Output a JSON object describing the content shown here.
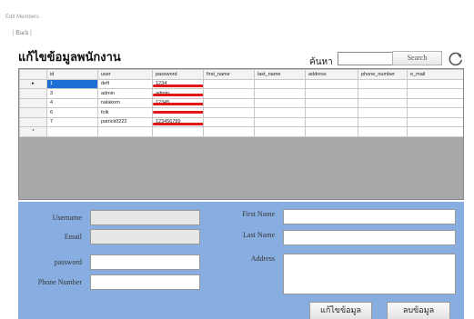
{
  "window": {
    "title": "Edit Members"
  },
  "nav": {
    "back_label": "| Back |"
  },
  "page": {
    "heading": "แก้ไขข้อมูลพนักงาน"
  },
  "search": {
    "label": "ค้นหา",
    "value": "",
    "button_label": "Search"
  },
  "grid": {
    "columns": [
      "id",
      "user",
      "password",
      "first_name",
      "last_name",
      "address",
      "phone_number",
      "e_mail"
    ],
    "rows": [
      {
        "marker": "▸",
        "id": "1",
        "user": "deft",
        "password": "1234"
      },
      {
        "marker": "",
        "id": "3",
        "user": "admin",
        "password": "admin"
      },
      {
        "marker": "",
        "id": "4",
        "user": "nalakom",
        "password": "12345"
      },
      {
        "marker": "",
        "id": "6",
        "user": "folk",
        "password": ""
      },
      {
        "marker": "",
        "id": "7",
        "user": "patrick0222",
        "password": "123456789"
      }
    ],
    "new_row_marker": "*"
  },
  "form": {
    "username_label": "Username",
    "email_label": "Email",
    "password_label": "password",
    "phone_label": "Phone Number",
    "first_name_label": "First Name",
    "last_name_label": "Last Name",
    "address_label": "Address",
    "edit_button": "แก้ไขข้อมูล",
    "delete_button": "ลบข้อมูล"
  },
  "colors": {
    "panel": "#88aee1",
    "selection": "#1b6fd6",
    "redaction": "#e01818"
  }
}
